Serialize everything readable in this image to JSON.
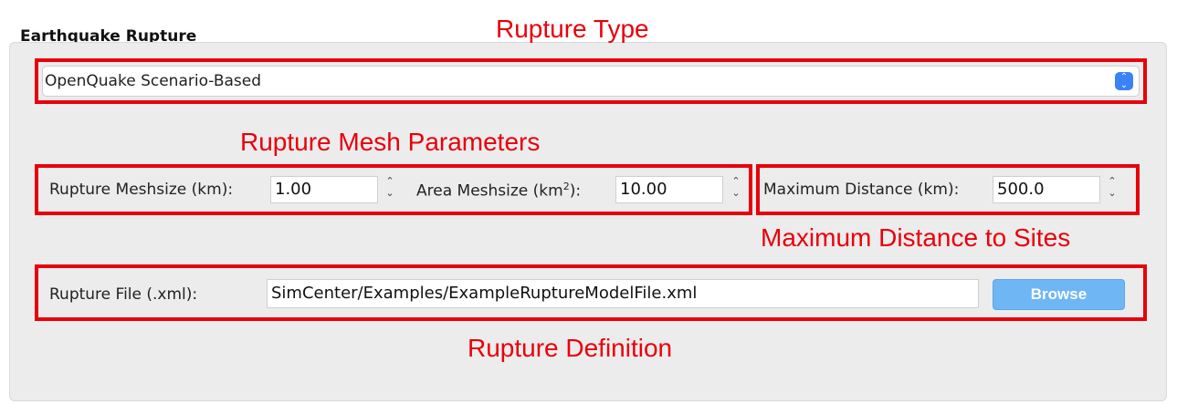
{
  "group": {
    "title": "Earthquake Rupture"
  },
  "annotations": {
    "rupture_type": "Rupture Type",
    "mesh_params": "Rupture Mesh Parameters",
    "max_distance": "Maximum Distance to Sites",
    "rupture_definition": "Rupture Definition"
  },
  "rupture_type_select": {
    "value": "OpenQuake Scenario-Based"
  },
  "mesh": {
    "meshsize_label": "Rupture Meshsize (km):",
    "meshsize_value": "1.00",
    "area_label_prefix": "Area Meshsize (km",
    "area_label_sup": "2",
    "area_label_suffix": "):",
    "area_value": "10.00"
  },
  "distance": {
    "label": "Maximum Distance (km):",
    "value": "500.0"
  },
  "rupture_file": {
    "label": "Rupture File (.xml):",
    "path": "SimCenter/Examples/ExampleRuptureModelFile.xml",
    "browse_label": "Browse"
  },
  "icons": {
    "combo_arrow": "updown-chevron-icon",
    "spin_arrows": "spinbox-arrows-icon"
  },
  "colors": {
    "annotation": "#e8000b",
    "accent": "#3a82f7",
    "browse_button": "#6fb6f5"
  }
}
